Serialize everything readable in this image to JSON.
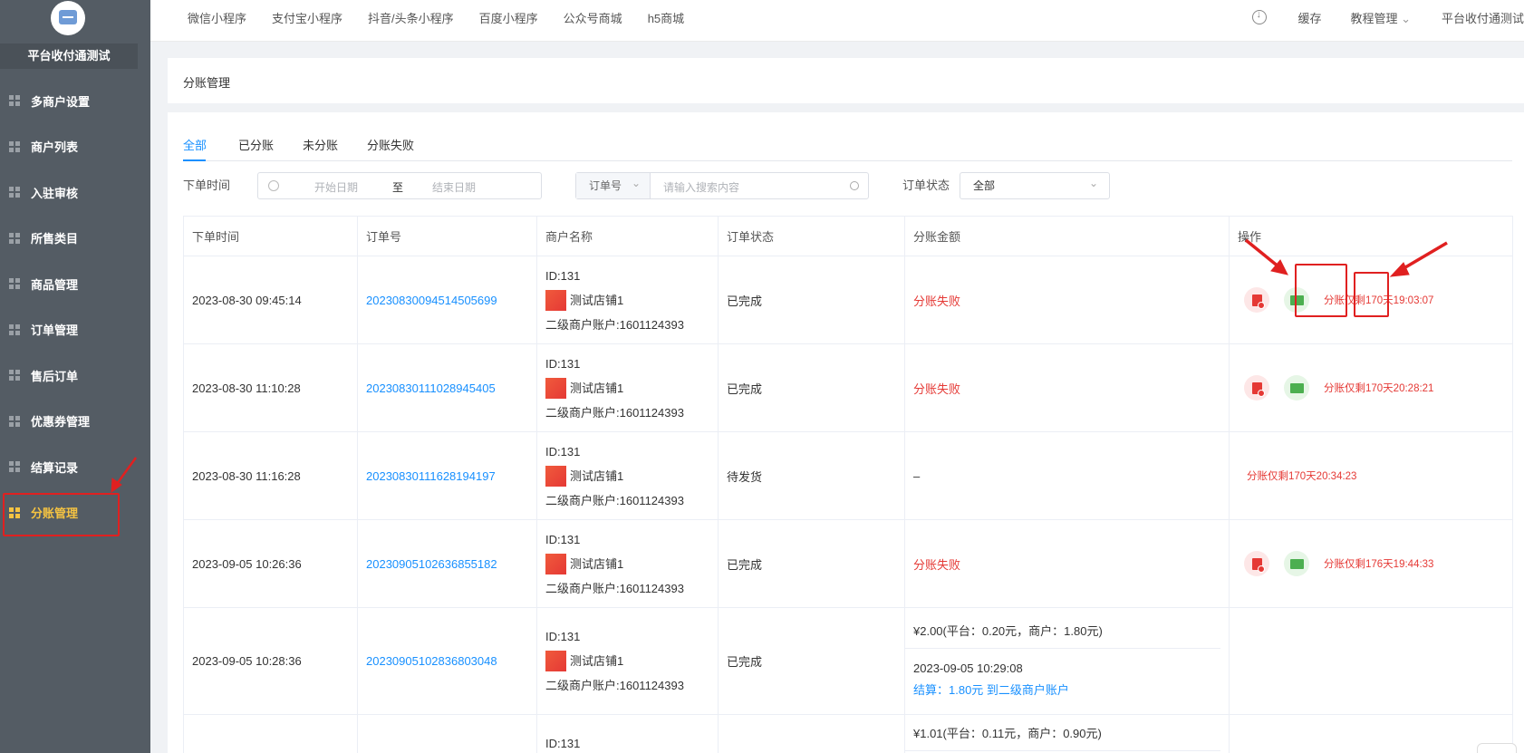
{
  "sidebar": {
    "store_name": "平台收付通测试",
    "items": [
      {
        "label": "多商户设置"
      },
      {
        "label": "商户列表"
      },
      {
        "label": "入驻审核"
      },
      {
        "label": "所售类目"
      },
      {
        "label": "商品管理"
      },
      {
        "label": "订单管理"
      },
      {
        "label": "售后订单"
      },
      {
        "label": "优惠券管理"
      },
      {
        "label": "结算记录"
      },
      {
        "label": "分账管理"
      }
    ],
    "active_label": "分账管理"
  },
  "topbar": {
    "nav": [
      "微信小程序",
      "支付宝小程序",
      "抖音/头条小程序",
      "百度小程序",
      "公众号商城",
      "h5商城"
    ],
    "cache": "缓存",
    "tutorial": "教程管理",
    "account": "平台收付通测试"
  },
  "page_title": "分账管理",
  "tabs": [
    "全部",
    "已分账",
    "未分账",
    "分账失败"
  ],
  "filters": {
    "order_time_label": "下单时间",
    "start_placeholder": "开始日期",
    "to": "至",
    "end_placeholder": "结束日期",
    "search_type": "订单号",
    "search_placeholder": "请输入搜索内容",
    "status_label": "订单状态",
    "status_value": "全部"
  },
  "table": {
    "headers": [
      "下单时间",
      "订单号",
      "商户名称",
      "订单状态",
      "分账金额",
      "操作"
    ],
    "rows": [
      {
        "time": "2023-08-30 09:45:14",
        "order_no": "20230830094514505699",
        "merchant_id": "ID:131",
        "merchant_name": "测试店铺1",
        "merchant_account": "二级商户账户:1601124393",
        "status": "已完成",
        "split": "分账失败",
        "countdown": "分账仅剩170天19:03:07"
      },
      {
        "time": "2023-08-30 11:10:28",
        "order_no": "20230830111028945405",
        "merchant_id": "ID:131",
        "merchant_name": "测试店铺1",
        "merchant_account": "二级商户账户:1601124393",
        "status": "已完成",
        "split": "分账失败",
        "countdown": "分账仅剩170天20:28:21"
      },
      {
        "time": "2023-08-30 11:16:28",
        "order_no": "20230830111628194197",
        "merchant_id": "ID:131",
        "merchant_name": "测试店铺1",
        "merchant_account": "二级商户账户:1601124393",
        "status": "待发货",
        "split": "–",
        "countdown": "分账仅剩170天20:34:23"
      },
      {
        "time": "2023-09-05 10:26:36",
        "order_no": "20230905102636855182",
        "merchant_id": "ID:131",
        "merchant_name": "测试店铺1",
        "merchant_account": "二级商户账户:1601124393",
        "status": "已完成",
        "split": "分账失败",
        "countdown": "分账仅剩176天19:44:33"
      },
      {
        "time": "2023-09-05 10:28:36",
        "order_no": "20230905102836803048",
        "merchant_id": "ID:131",
        "merchant_name": "测试店铺1",
        "merchant_account": "二级商户账户:1601124393",
        "status": "已完成",
        "split_amount": "¥2.00(平台：0.20元，商户：1.80元)",
        "split_time": "2023-09-05 10:29:08",
        "split_settle": "结算：1.80元 到二级商户账户"
      },
      {
        "merchant_id": "ID:131",
        "split_amount": "¥1.01(平台：0.11元，商户：0.90元)"
      }
    ]
  },
  "colors": {
    "sidebar_bg": "#545c64",
    "accent": "#1890ff",
    "active_menu": "#f5c342",
    "danger": "#e53935"
  }
}
